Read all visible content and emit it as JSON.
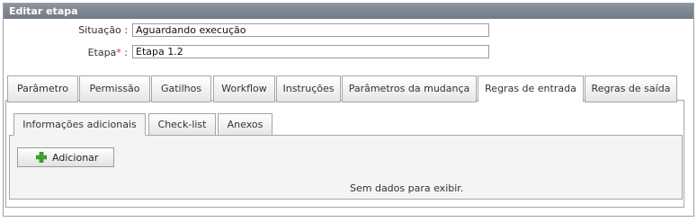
{
  "panel": {
    "title": "Editar etapa"
  },
  "form": {
    "situacao": {
      "label": "Situação :",
      "value": "Aguardando execução"
    },
    "etapa": {
      "label": "Etapa",
      "required_mark": "*",
      "label_suffix": " :",
      "value": "Etapa 1.2"
    }
  },
  "main_tabs": [
    {
      "label": "Parâmetro",
      "active": false
    },
    {
      "label": "Permissão",
      "active": false
    },
    {
      "label": "Gatilhos",
      "active": false
    },
    {
      "label": "Workflow",
      "active": false
    },
    {
      "label": "Instruções",
      "active": false
    },
    {
      "label": "Parâmetros da mudança",
      "active": false
    },
    {
      "label": "Regras de entrada",
      "active": true
    },
    {
      "label": "Regras de saída",
      "active": false
    }
  ],
  "sub_tabs": [
    {
      "label": "Informações adicionais",
      "active": true
    },
    {
      "label": "Check-list",
      "active": false
    },
    {
      "label": "Anexos",
      "active": false
    }
  ],
  "toolbar": {
    "add_label": "Adicionar",
    "add_icon": "plus-icon"
  },
  "grid": {
    "empty_message": "Sem dados para exibir."
  },
  "colors": {
    "header_bg": "#7f8691",
    "required": "#d12b2b",
    "plus_green": "#3aa52a"
  }
}
